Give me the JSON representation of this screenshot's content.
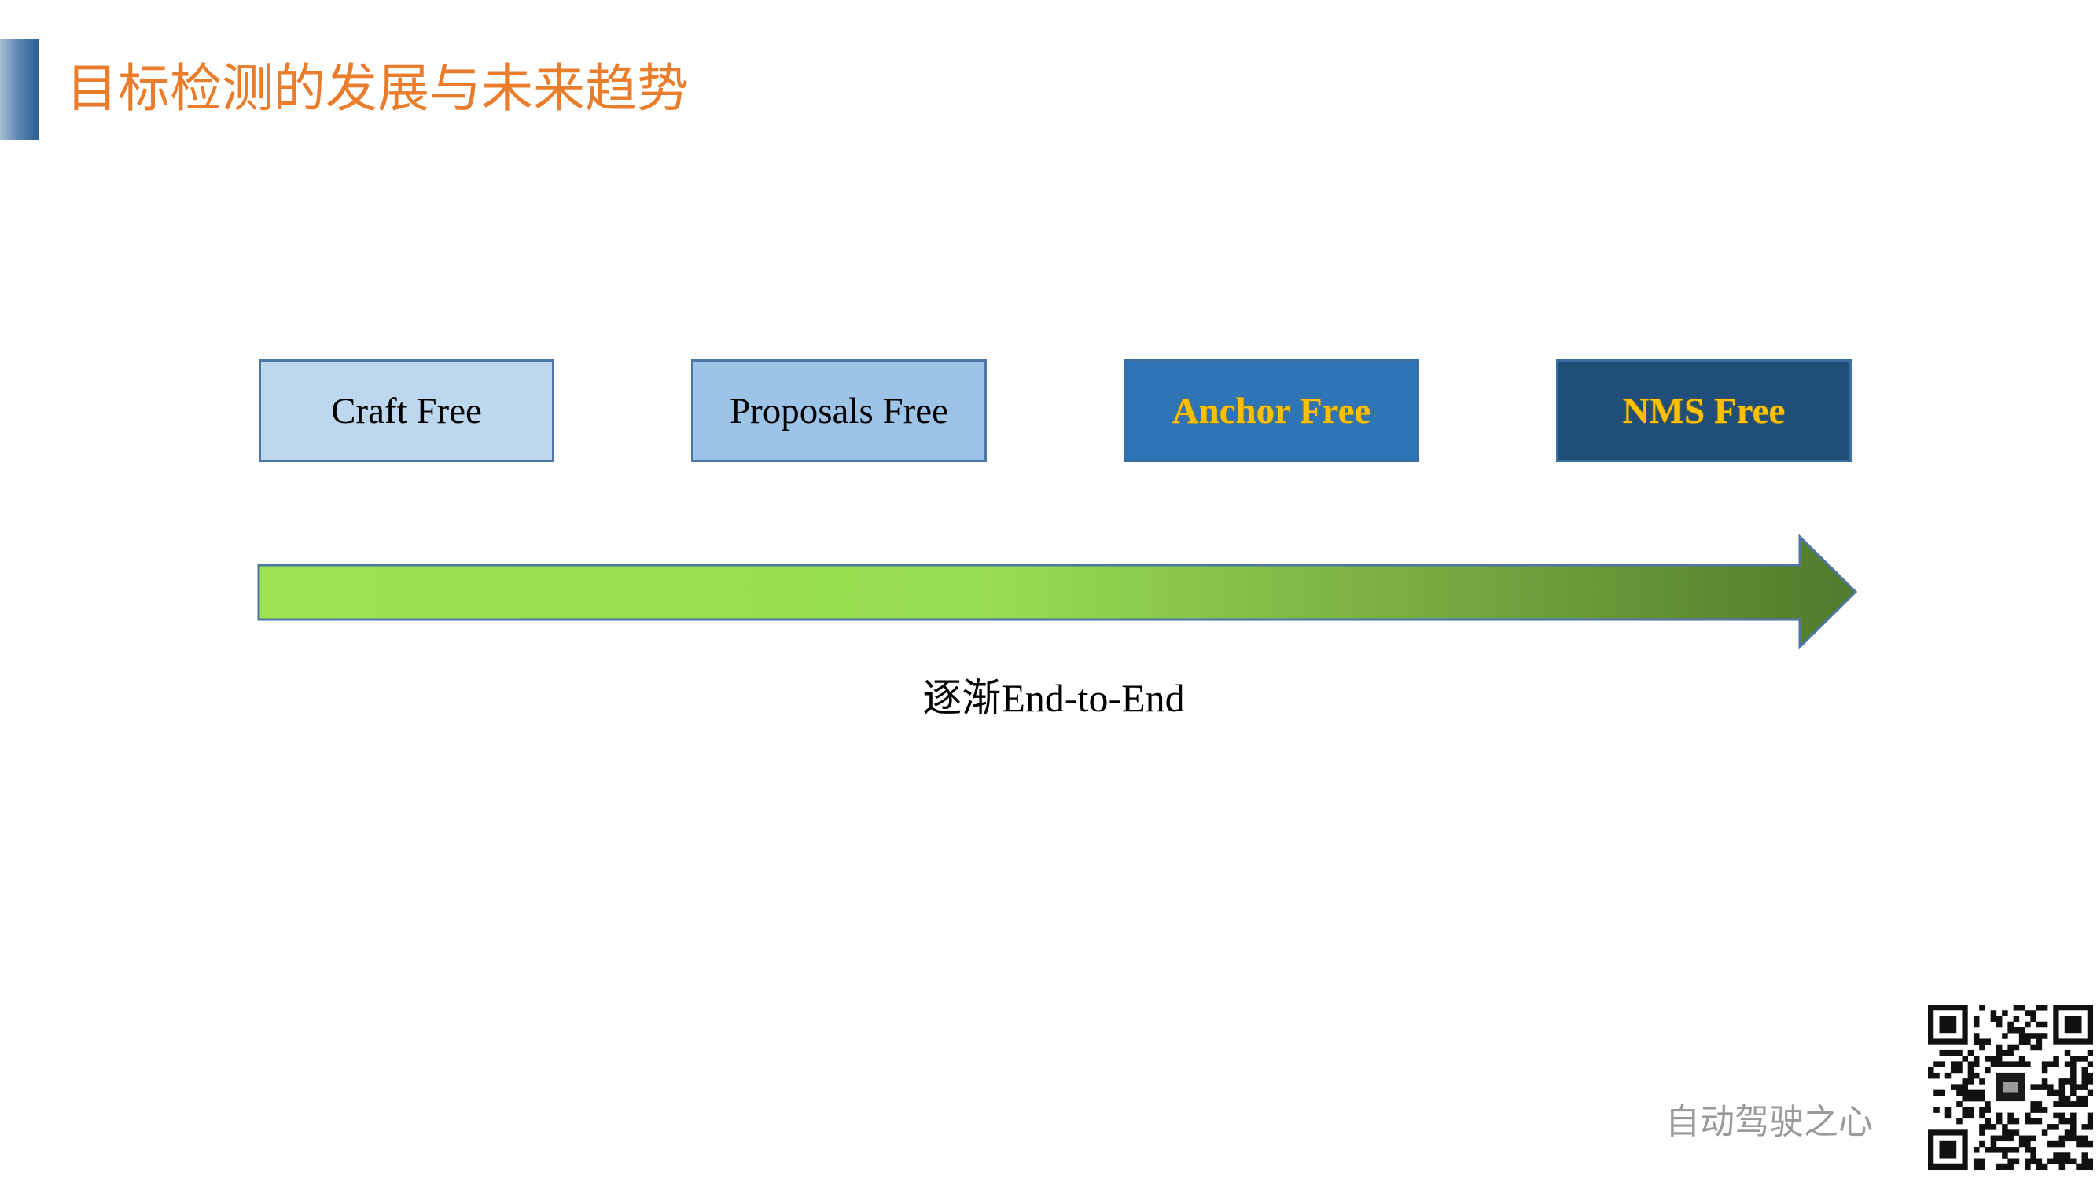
{
  "slide": {
    "title": "目标检测的发展与未来趋势"
  },
  "stages": [
    {
      "label": "Craft Free"
    },
    {
      "label": "Proposals Free"
    },
    {
      "label": "Anchor Free"
    },
    {
      "label": "NMS Free"
    }
  ],
  "trend": {
    "label": "逐渐End-to-End"
  },
  "footer": {
    "brand": "自动驾驶之心"
  },
  "colors": {
    "title": "#ea7d2c",
    "stage_1_fill": "#bdd7ee",
    "stage_2_fill": "#9dc3e6",
    "stage_3_fill": "#2e75b6",
    "stage_4_fill": "#1f4e79",
    "highlight_text": "#ffc000",
    "arrow_start": "#9ee252",
    "arrow_end": "#4f7a2c"
  }
}
